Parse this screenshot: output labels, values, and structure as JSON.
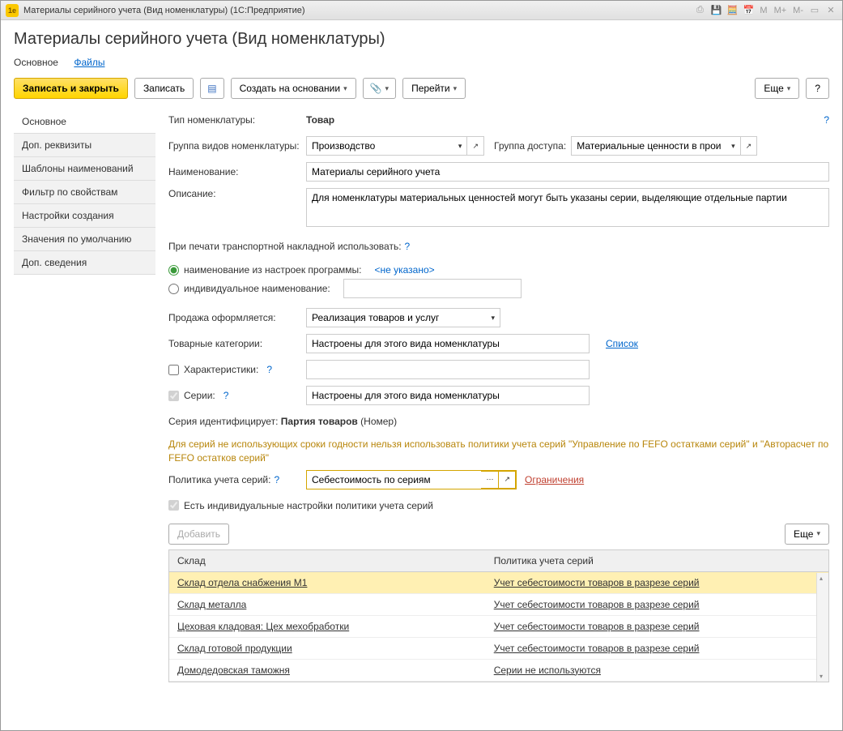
{
  "titlebar": {
    "icon_text": "1e",
    "text": "Материалы серийного учета (Вид номенклатуры)  (1С:Предприятие)",
    "m_buttons": [
      "M",
      "M+",
      "M-"
    ]
  },
  "page_title": "Материалы серийного учета (Вид номенклатуры)",
  "nav": {
    "main": "Основное",
    "files": "Файлы"
  },
  "toolbar": {
    "save_close": "Записать и закрыть",
    "save": "Записать",
    "create_based": "Создать на основании",
    "goto": "Перейти",
    "more": "Еще",
    "help": "?"
  },
  "sidebar": {
    "items": [
      {
        "label": "Основное"
      },
      {
        "label": "Доп. реквизиты"
      },
      {
        "label": "Шаблоны наименований"
      },
      {
        "label": "Фильтр по свойствам"
      },
      {
        "label": "Настройки создания"
      },
      {
        "label": "Значения по умолчанию"
      },
      {
        "label": "Доп. сведения"
      }
    ]
  },
  "form": {
    "type_label": "Тип номенклатуры:",
    "type_value": "Товар",
    "group_label": "Группа видов номенклатуры:",
    "group_value": "Производство",
    "access_label": "Группа доступа:",
    "access_value": "Материальные ценности в производс",
    "name_label": "Наименование:",
    "name_value": "Материалы серийного учета",
    "desc_label": "Описание:",
    "desc_value": "Для номенклатуры материальных ценностей могут быть указаны серии, выделяющие отдельные партии",
    "print_label": "При печати транспортной накладной использовать:",
    "radio1": "наименование из настроек программы:",
    "radio1_link": "<не указано>",
    "radio2": "индивидуальное наименование:",
    "sale_label": "Продажа оформляется:",
    "sale_value": "Реализация товаров и услуг",
    "cat_label": "Товарные категории:",
    "cat_value": "Настроены для этого вида номенклатуры",
    "cat_link": "Список",
    "char_label": "Характеристики:",
    "series_label": "Серии:",
    "series_value": "Настроены для этого вида номенклатуры",
    "series_ident_label": "Серия идентифицирует:",
    "series_ident_value": "Партия товаров",
    "series_ident_suffix": "(Номер)",
    "note": "Для серий не использующих сроки годности нельзя использовать политики учета серий \"Управление по FEFO остатками серий\" и \"Авторасчет по FEFO остатков серий\"",
    "policy_label": "Политика учета серий:",
    "policy_value": "Себестоимость по сериям",
    "restrict_link": "Ограничения",
    "indiv_check": "Есть индивидуальные настройки политики учета серий",
    "add_btn": "Добавить",
    "more_btn": "Еще"
  },
  "table": {
    "col1": "Склад",
    "col2": "Политика учета серий",
    "rows": [
      {
        "c1": "Склад отдела снабжения М1",
        "c2": "Учет себестоимости товаров в разрезе серий"
      },
      {
        "c1": "Склад металла",
        "c2": "Учет себестоимости товаров в разрезе серий"
      },
      {
        "c1": "Цеховая кладовая: Цех мехобработки",
        "c2": "Учет себестоимости товаров в разрезе серий"
      },
      {
        "c1": "Склад готовой продукции",
        "c2": "Учет себестоимости товаров в разрезе серий"
      },
      {
        "c1": "Домодедовская таможня",
        "c2": "Серии не используются"
      }
    ]
  }
}
